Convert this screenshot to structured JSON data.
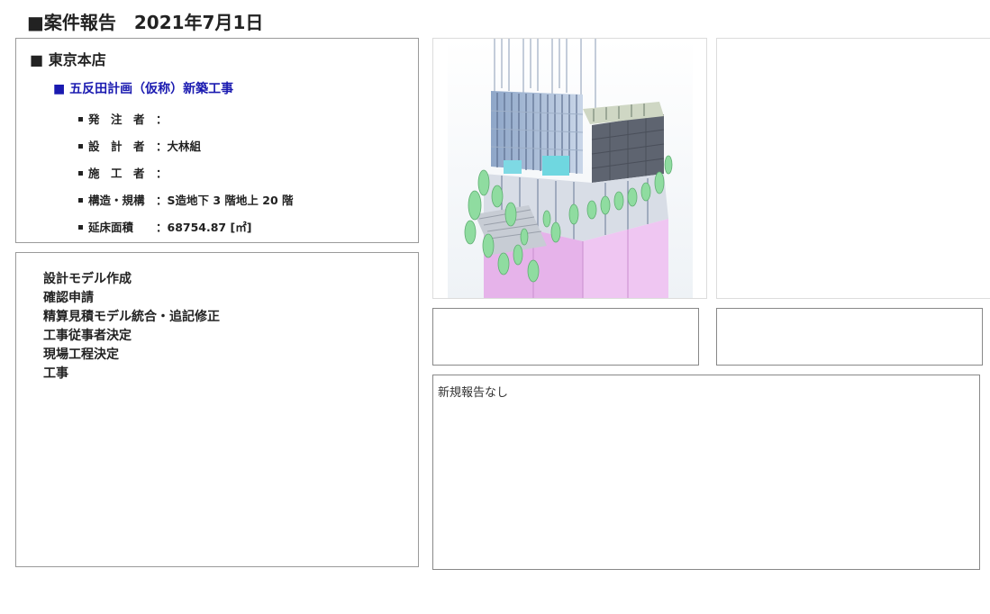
{
  "header": {
    "title": "■案件報告　2021年7月1日"
  },
  "project_info": {
    "branch": "■ 東京本店",
    "project_name": "■ 五反田計画（仮称）新築工事",
    "details": [
      {
        "label": "発　注　者",
        "value": "："
      },
      {
        "label": "設　計　者",
        "value": "：大林組"
      },
      {
        "label": "施　工　者",
        "value": "："
      },
      {
        "label": "構造・規構",
        "value": "：S造地下 3 階地上 20 階"
      },
      {
        "label": "延床面積",
        "value": "：68754.87 [㎡]"
      }
    ]
  },
  "tasks": [
    "設計モデル作成",
    "確認申請",
    "精算見積モデル統合・追記修正",
    "工事従事者決定",
    "現場工程決定",
    "工事"
  ],
  "report": {
    "text": "新規報告なし"
  },
  "colors": {
    "project_name": "#1a1ab0",
    "border": "#9a9a9a",
    "facade_pink": "#e8a8e8",
    "tree_green": "#8fdca0"
  }
}
